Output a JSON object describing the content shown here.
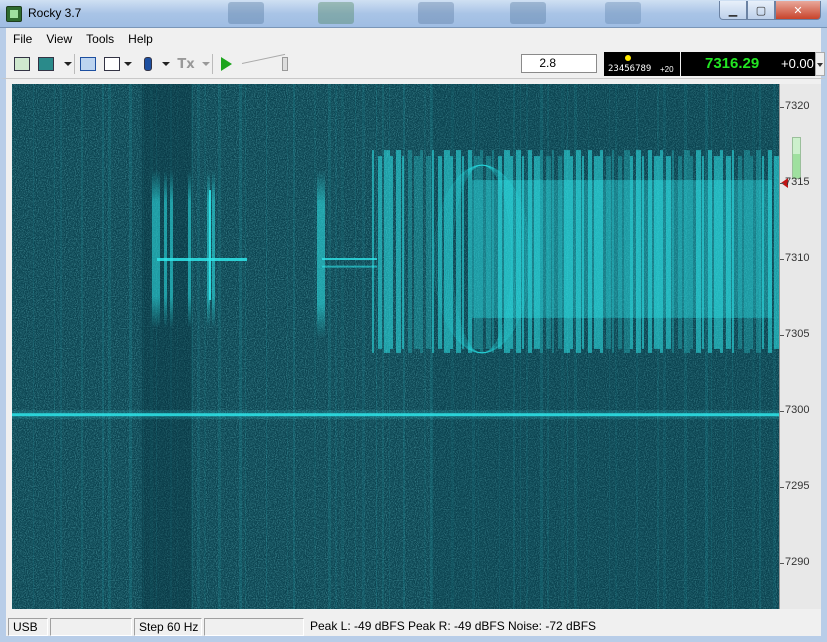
{
  "window": {
    "title": "Rocky 3.7"
  },
  "menu": [
    "File",
    "View",
    "Tools",
    "Help"
  ],
  "toolbar": {
    "bandwidth_value": "2.8",
    "digit_display": {
      "digits": "23456789",
      "offset": "+20"
    },
    "frequency": "7316.29",
    "rit_offset": "+0.00"
  },
  "waterfall": {
    "signal_color": "#2fe6ea",
    "background_color": "#0b4350",
    "carrier_frequency_khz": 7299.8,
    "freq_range_khz": [
      7287,
      7321.5
    ]
  },
  "scale": {
    "ticks": [
      "7320",
      "7315",
      "7310",
      "7305",
      "7300",
      "7295",
      "7290"
    ],
    "level": 0.6
  },
  "status": {
    "mode": "USB",
    "blank1": "",
    "step": "Step 60 Hz",
    "blank2": "",
    "peak_l": "Peak L: -49 dBFS",
    "peak_r": "Peak R: -49 dBFS",
    "noise": "Noise: -72 dBFS"
  }
}
